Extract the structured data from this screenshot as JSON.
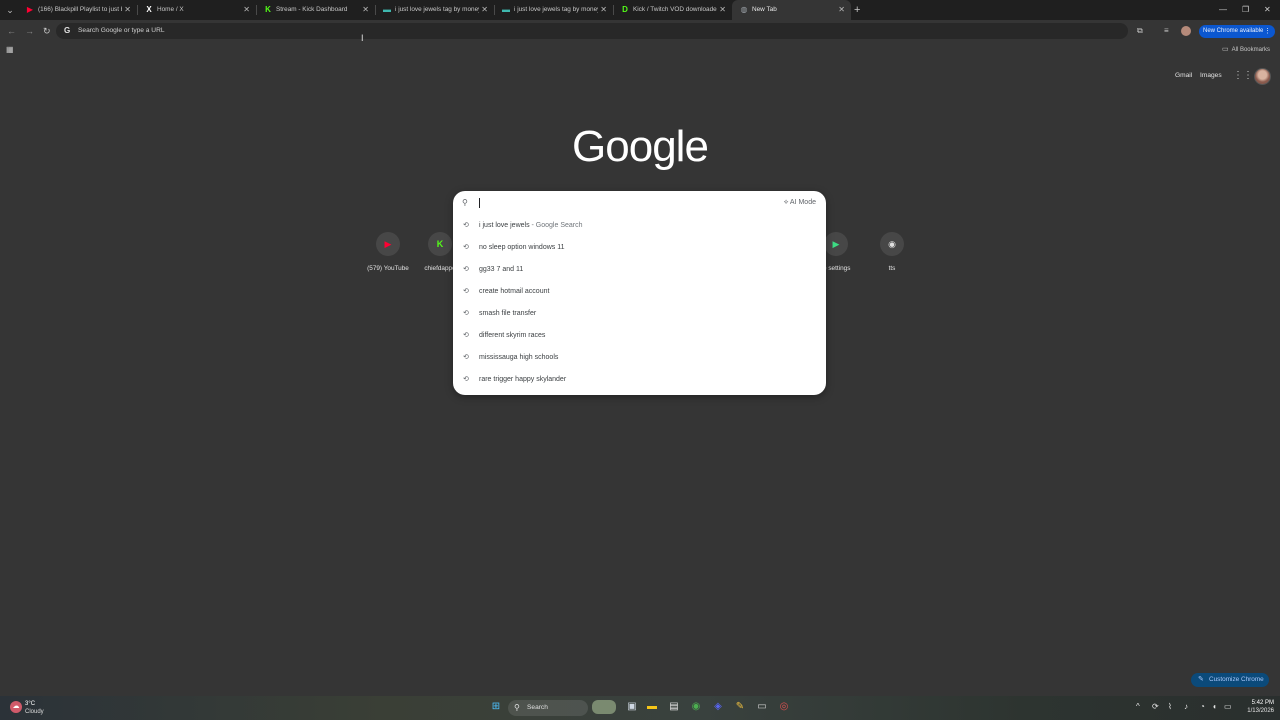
{
  "tabs": [
    {
      "title": "(166) Blackpill Playlist to just be",
      "icon": "youtube-icon",
      "color": "#ff0033",
      "glyph": "▶"
    },
    {
      "title": "Home / X",
      "icon": "x-icon",
      "color": "#ffffff",
      "glyph": "𝕏"
    },
    {
      "title": "Stream - Kick Dashboard",
      "icon": "kick-icon",
      "color": "#53fc18",
      "glyph": "K"
    },
    {
      "title": "i just love jewels tag by money",
      "icon": "jewels-icon",
      "color": "#3fb8af",
      "glyph": "—"
    },
    {
      "title": "i just love jewels tag by money",
      "icon": "jewels-icon",
      "color": "#3fb8af",
      "glyph": "—"
    },
    {
      "title": "Kick / Twitch VOD downloader",
      "icon": "downloader-icon",
      "color": "#53fc18",
      "glyph": "D"
    },
    {
      "title": "New Tab",
      "icon": "chrome-newtab-icon",
      "color": "#9aa0a6",
      "glyph": "◍",
      "active": true
    }
  ],
  "toolbar": {
    "omnibox_placeholder": "Search Google or type a URL",
    "update_label": "New Chrome available"
  },
  "bookmarks": {
    "all_bookmarks": "All Bookmarks"
  },
  "top_links": {
    "gmail": "Gmail",
    "images": "Images"
  },
  "logo": "Google",
  "search": {
    "ai_mode": "AI Mode",
    "suggestions": [
      {
        "text": "i just love jewels",
        "suffix": " - Google Search"
      },
      {
        "text": "no sleep option windows 11",
        "suffix": ""
      },
      {
        "text": "gg33 7 and 11",
        "suffix": ""
      },
      {
        "text": "create hotmail account",
        "suffix": ""
      },
      {
        "text": "smash file transfer",
        "suffix": ""
      },
      {
        "text": "different skyrim races",
        "suffix": ""
      },
      {
        "text": "mississauga high schools",
        "suffix": ""
      },
      {
        "text": "rare trigger happy skylander",
        "suffix": ""
      }
    ]
  },
  "shortcuts": [
    {
      "label": "(579) YouTube",
      "icon": "youtube-icon",
      "color": "#ff0033"
    },
    {
      "label": "chiefdappe",
      "icon": "kick-icon",
      "color": "#53fc18"
    },
    {
      "label": "le settings",
      "icon": "play-icon",
      "color": "#3ddc84"
    },
    {
      "label": "tts",
      "icon": "tts-icon",
      "color": "#e0e0e0"
    }
  ],
  "customize_label": "Customize Chrome",
  "taskbar": {
    "weather_temp": "3°C",
    "weather_desc": "Cloudy",
    "search_label": "Search",
    "time": "5:42 PM",
    "date": "1/13/2026"
  },
  "colors": {
    "accent": "#0b57d0",
    "page_bg": "#353535",
    "tabstrip_bg": "#1f1f1f"
  }
}
